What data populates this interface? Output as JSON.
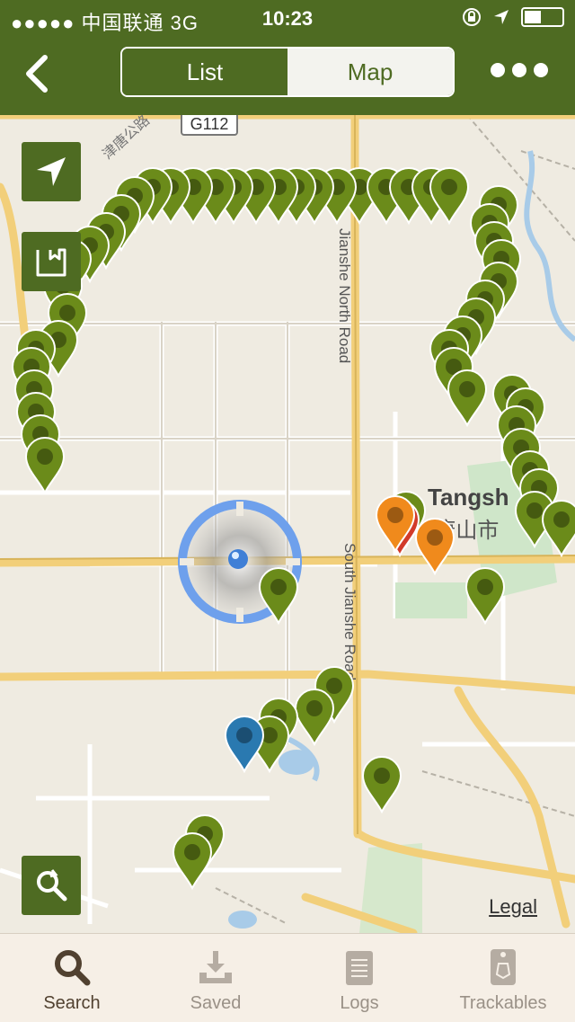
{
  "status": {
    "carrier": "●●●●● 中国联通 3G",
    "time": "10:23"
  },
  "nav": {
    "list_label": "List",
    "map_label": "Map"
  },
  "map": {
    "legal": "Legal",
    "roads": {
      "g112": "G112",
      "jianshe_north": "Jianshe North Road",
      "jianshe_south": "South Jianshe Road"
    },
    "city": {
      "name_en": "Tangsh",
      "name_cn": "(唐山市"
    },
    "chinese_road": "津唐公路",
    "colors": {
      "green": "#6b8b1a",
      "orange": "#f08a1c",
      "blue": "#2a79b0",
      "red": "#d23a2a"
    }
  },
  "tabs": [
    {
      "label": "Search",
      "icon": "search-icon"
    },
    {
      "label": "Saved",
      "icon": "download-icon"
    },
    {
      "label": "Logs",
      "icon": "notepad-icon"
    },
    {
      "label": "Trackables",
      "icon": "trackable-tag-icon"
    }
  ]
}
